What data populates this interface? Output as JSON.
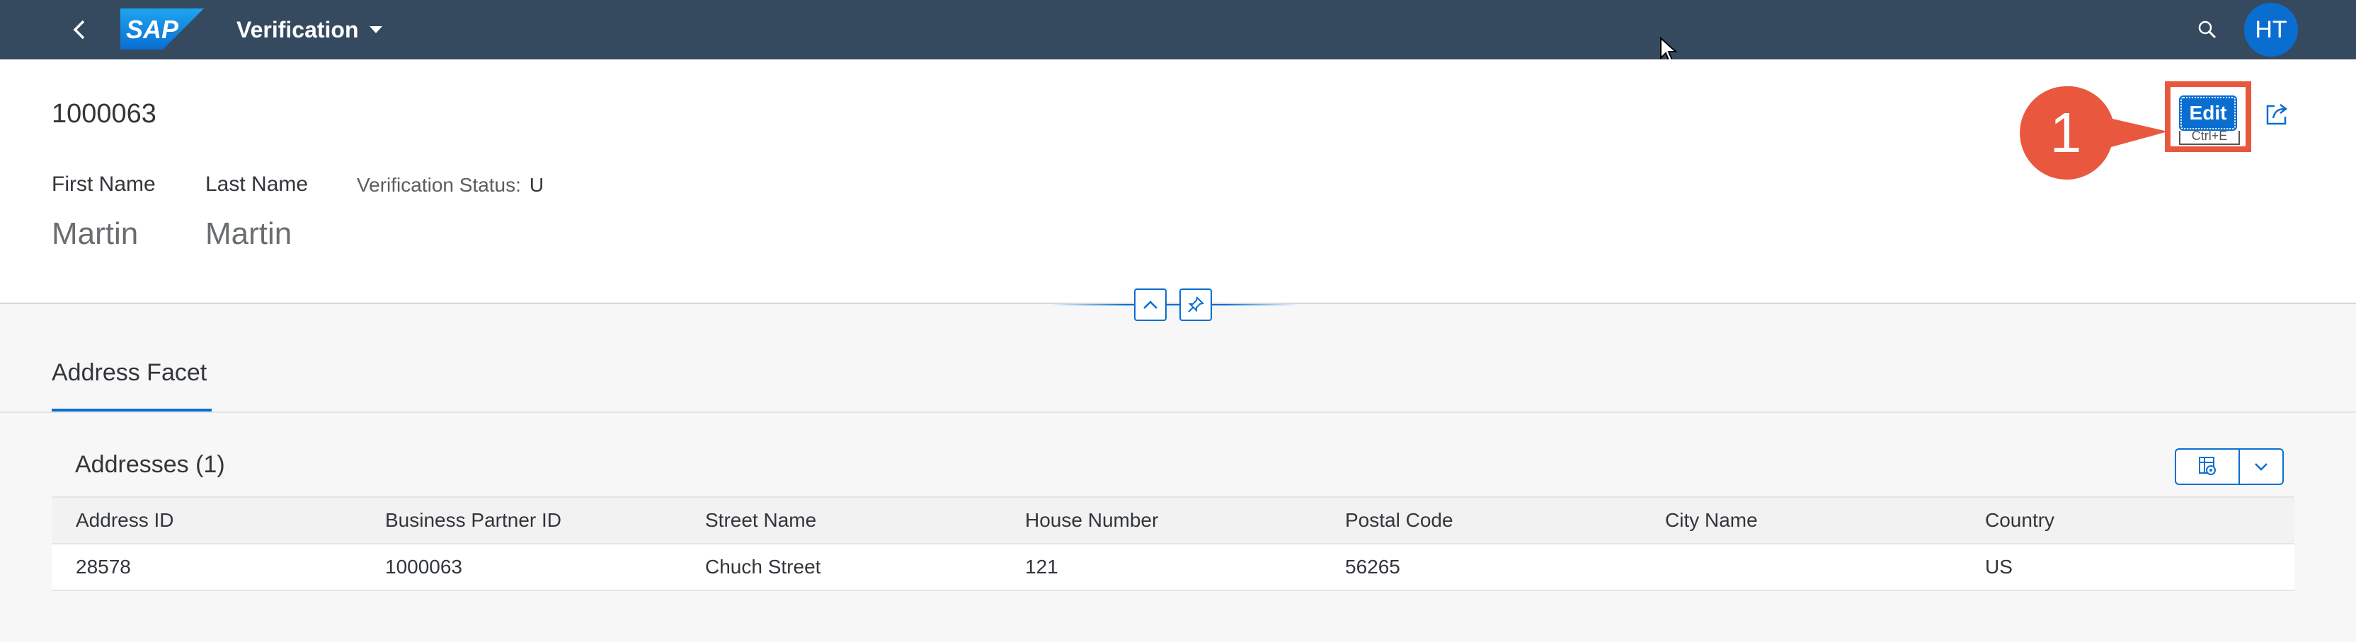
{
  "shell": {
    "app_title": "Verification",
    "logo_text": "SAP",
    "avatar_initials": "HT"
  },
  "header": {
    "object_id": "1000063",
    "first_name_label": "First Name",
    "last_name_label": "Last Name",
    "first_name_value": "Martin",
    "last_name_value": "Martin",
    "status_label": "Verification Status:",
    "status_value": "U",
    "edit_label": "Edit",
    "edit_tooltip": "Ctrl+E"
  },
  "callout": {
    "number": "1",
    "color": "#e9573e"
  },
  "tabs": [
    {
      "label": "Address Facet"
    }
  ],
  "table": {
    "title": "Addresses (1)",
    "columns": [
      "Address ID",
      "Business Partner ID",
      "Street Name",
      "House Number",
      "Postal Code",
      "City Name",
      "Country"
    ],
    "rows": [
      [
        "28578",
        "1000063",
        "Chuch Street",
        "121",
        "56265",
        "",
        "US"
      ]
    ]
  },
  "colors": {
    "shell": "#354a5f",
    "accent": "#0a6ed1",
    "callout": "#e9573e"
  },
  "icons": [
    "back-icon",
    "dropdown-caret-icon",
    "search-icon",
    "share-icon",
    "collapse-header-icon",
    "pin-icon",
    "table-settings-icon",
    "chevron-down-icon"
  ]
}
